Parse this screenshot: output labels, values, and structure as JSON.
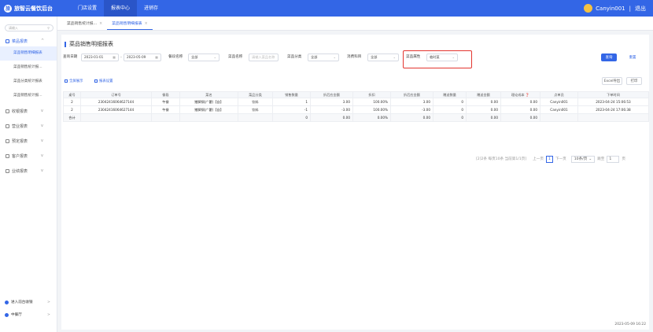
{
  "app": {
    "logo_text": "旅智云餐饮后台",
    "logo_mark": "旅"
  },
  "topnav": [
    {
      "label": "门店设置"
    },
    {
      "label": "报表中心"
    },
    {
      "label": "进销存"
    }
  ],
  "user": {
    "name": "Canyin001",
    "separator": "|",
    "logout": "退出"
  },
  "sidebar": {
    "search_placeholder": "请输入",
    "groups": [
      {
        "label": "菜品报表",
        "chev": "^"
      },
      {
        "label": "收银报表",
        "chev": "v"
      },
      {
        "label": "营业报表",
        "chev": "v"
      },
      {
        "label": "预定报表",
        "chev": "v"
      },
      {
        "label": "客户报表",
        "chev": "v"
      },
      {
        "label": "业绩报表",
        "chev": "v"
      }
    ],
    "sub_items": [
      {
        "label": "菜品销售明细报表"
      },
      {
        "label": "菜品销售统计报..."
      },
      {
        "label": "菜品分类统计报表"
      },
      {
        "label": "菜品销售统计报..."
      }
    ],
    "footer": [
      {
        "label": "进入前台收银",
        "chev": ">"
      },
      {
        "label": "中餐厅",
        "chev": ">"
      }
    ]
  },
  "tabs": [
    {
      "label": "菜品销售统计报...",
      "close": "×"
    },
    {
      "label": "菜品销售明细报表",
      "close": "×"
    }
  ],
  "page_title": "菜品销售明细报表",
  "filters": {
    "query_date_label": "查询日期",
    "date_start": "2023-01-01",
    "date_end": "2023-05-09",
    "date_sep": "-",
    "meal_label": "餐段名称",
    "meal_value": "全部",
    "dish_name_label": "菜品名称",
    "dish_name_placeholder": "请输入菜品名称",
    "category_label": "菜品分类",
    "category_value": "全部",
    "consume_label": "消费科目",
    "consume_value": "全部",
    "attr_label": "菜品属性",
    "attr_value": "临时菜"
  },
  "buttons": {
    "query": "查询",
    "reset": "重置",
    "expand": "全屏展示",
    "print_settings": "报表设置",
    "excel": "Excel导出",
    "print": "打印"
  },
  "table": {
    "headers": [
      "桌号",
      "订单号",
      "餐段",
      "菜名",
      "菜品分类",
      "销售数量",
      "折后应金额",
      "折扣",
      "折后应金额",
      "赠送数量",
      "赠送金额",
      "理论成本 ❓",
      "点单员",
      "下单时间"
    ],
    "rows": [
      [
        "2",
        "23042416064627144",
        "午餐",
        "猪脚锅(广藿)【自】",
        "饮料",
        "1",
        "3.00",
        "100.00%",
        "3.00",
        "0",
        "0.00",
        "0.00",
        "Canyin001",
        "2023-04-24 15:06:53"
      ],
      [
        "2",
        "23042416064627144",
        "午餐",
        "猪脚锅(广藿)【自】",
        "饮料",
        "-1",
        "-3.00",
        "100.00%",
        "-3.00",
        "0",
        "0.00",
        "0.00",
        "Canyin001",
        "2023-04-24 17:06:38"
      ]
    ],
    "summary": [
      "合计",
      "",
      "",
      "",
      "",
      "0",
      "0.00",
      "0.00%",
      "0.00",
      "0",
      "0.00",
      "0.00",
      "",
      ""
    ]
  },
  "pager": {
    "info": "[2]2条 每页10条 当前第1/1页]",
    "prev": "上一页",
    "page": "1",
    "next": "下一页",
    "size": "10条/页",
    "goto": "跳至",
    "goto_value": "1",
    "unit": "页"
  },
  "clock": "2023-05-09 16:22"
}
